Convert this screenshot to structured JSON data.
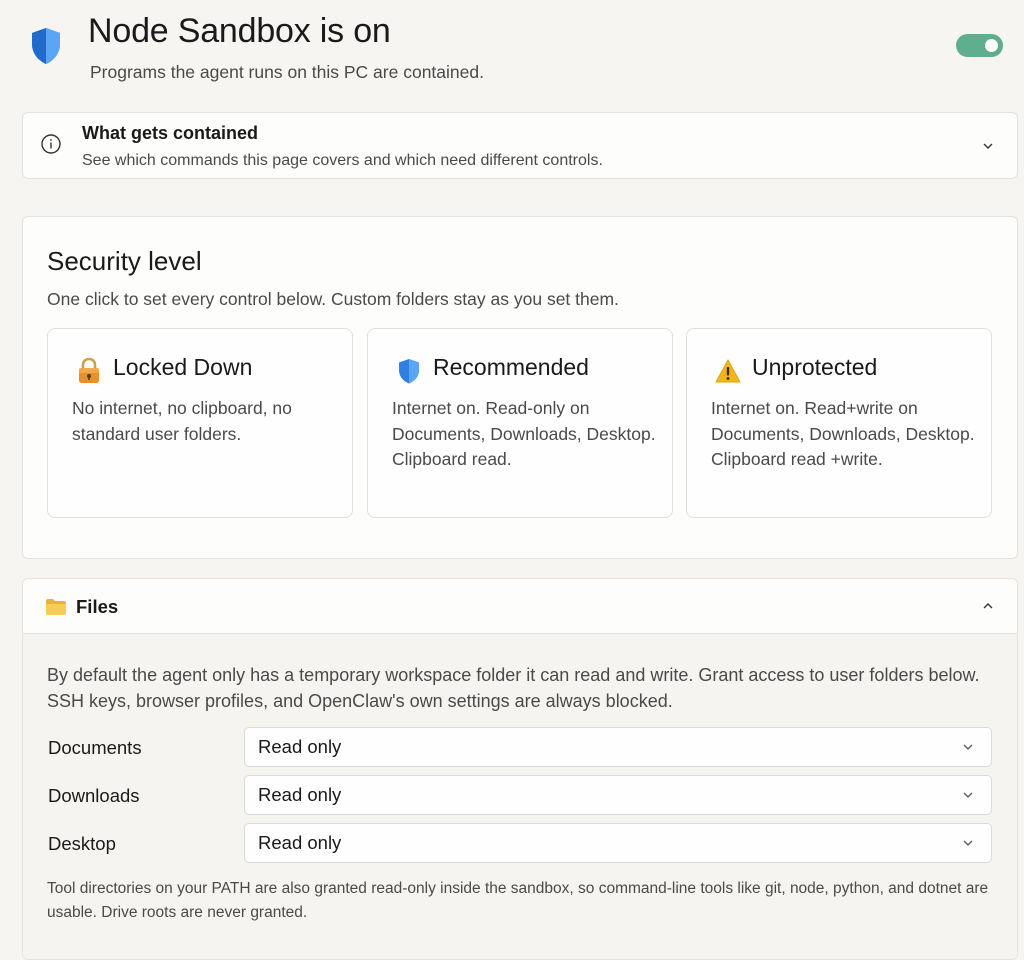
{
  "header": {
    "title": "Node Sandbox is on",
    "subtitle": "Programs the agent runs on this PC are contained.",
    "toggle_state": "on",
    "icon": "shield-icon"
  },
  "info": {
    "title": "What gets contained",
    "description": "See which commands this page covers and which need different controls.",
    "icon": "info-icon",
    "expanded": false
  },
  "security": {
    "title": "Security level",
    "description": "One click to set every control below. Custom folders stay as you set them.",
    "levels": [
      {
        "icon": "lock-icon",
        "title": "Locked Down",
        "description": "No internet, no clipboard, no standard user folders."
      },
      {
        "icon": "shield-icon",
        "title": "Recommended",
        "description": "Internet on. Read-only on Documents, Downloads, Desktop. Clipboard read."
      },
      {
        "icon": "warning-icon",
        "title": "Unprotected",
        "description": "Internet on. Read+write on Documents, Downloads, Desktop. Clipboard read +write."
      }
    ]
  },
  "files": {
    "title": "Files",
    "icon": "folder-icon",
    "expanded": true,
    "description": "By default the agent only has a temporary workspace folder it can read and write. Grant access to user folders below. SSH keys, browser profiles, and OpenClaw's own settings are always blocked.",
    "folders": [
      {
        "label": "Documents",
        "value": "Read only"
      },
      {
        "label": "Downloads",
        "value": "Read only"
      },
      {
        "label": "Desktop",
        "value": "Read only"
      }
    ],
    "note": "Tool directories on your PATH are also granted read-only inside the sandbox, so command-line tools like git, node, python, and dotnet are usable. Drive roots are never granted."
  },
  "colors": {
    "accent": "#5fae8e",
    "background": "#f7f5f2",
    "card": "#fdfdfc",
    "shield_blue": "#2f7fe0",
    "folder_yellow": "#f4c542",
    "lock_orange": "#e8902c",
    "warning_yellow": "#f2b51b"
  }
}
